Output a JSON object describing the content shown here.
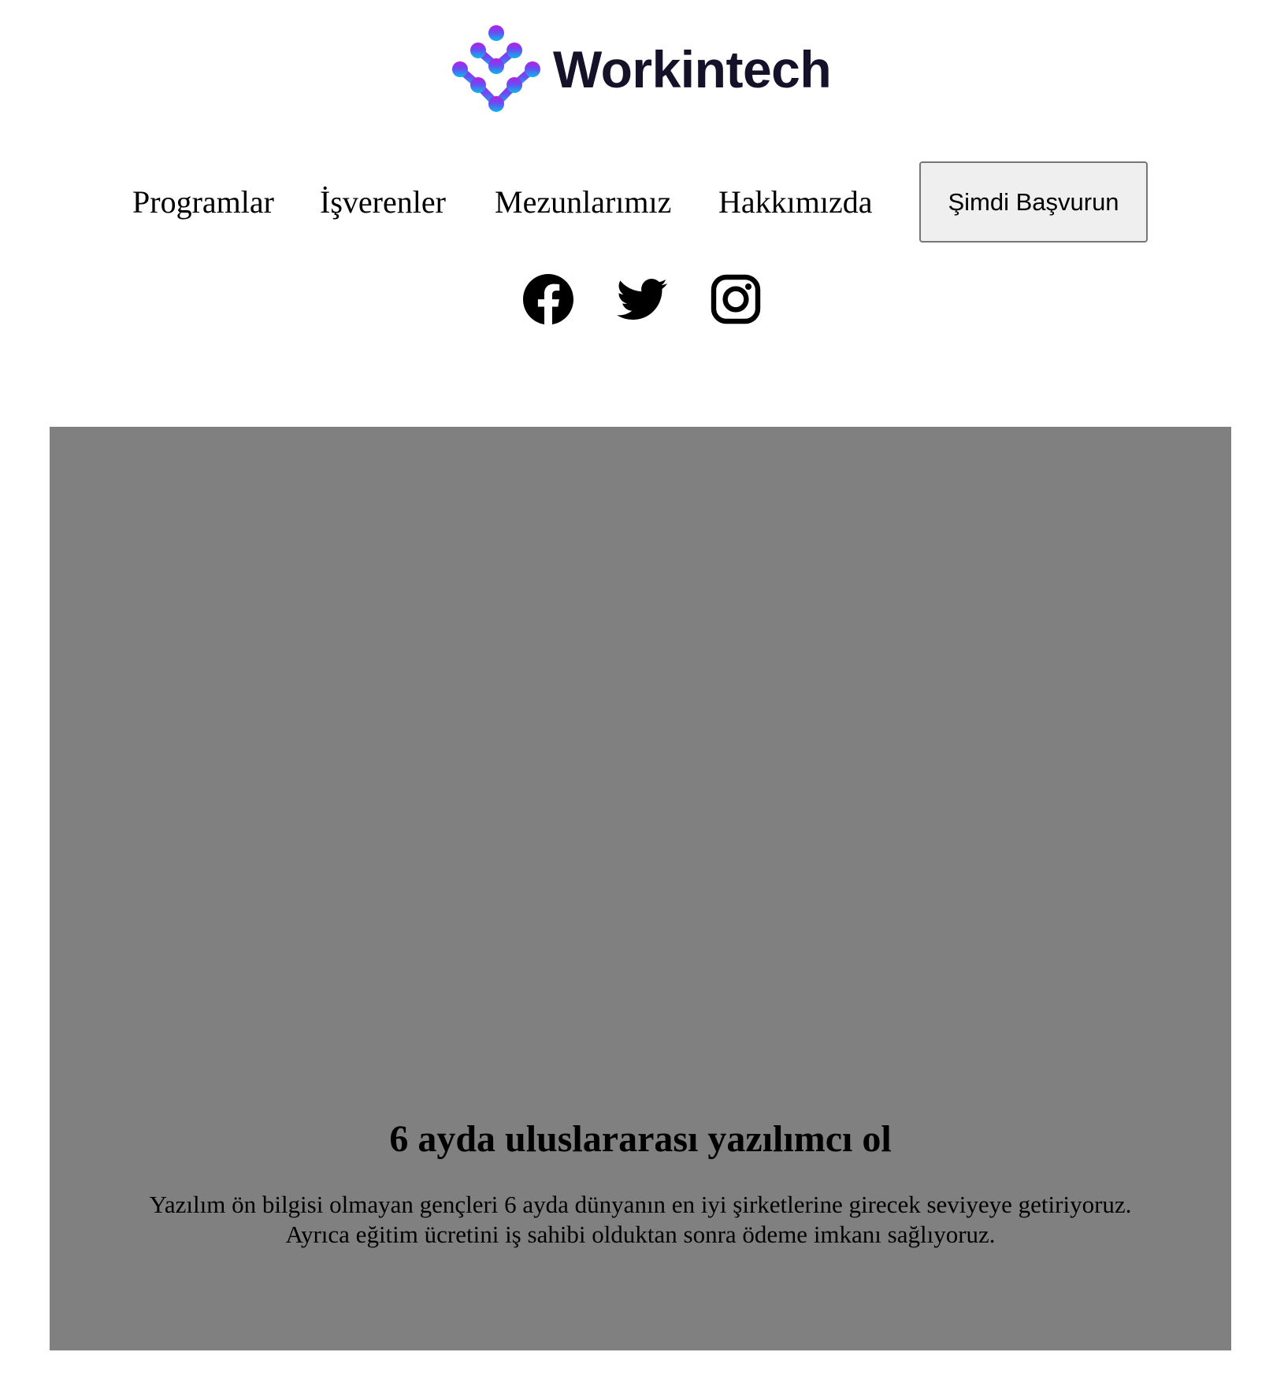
{
  "brand": {
    "name": "Workintech",
    "logo_icon": "workintech-logo-icon",
    "colors": {
      "logo_top": "#b81ee0",
      "logo_mid": "#6a4cf5",
      "logo_bottom": "#08b8ea",
      "text": "#151129"
    }
  },
  "nav": {
    "links": [
      {
        "label": "Programlar"
      },
      {
        "label": "İşverenler"
      },
      {
        "label": "Mezunlarımız"
      },
      {
        "label": "Hakkımızda"
      }
    ],
    "apply_label": "Şimdi Başvurun"
  },
  "socials": [
    {
      "icon": "facebook-icon"
    },
    {
      "icon": "twitter-icon"
    },
    {
      "icon": "instagram-icon"
    }
  ],
  "hero": {
    "background": "#808080",
    "title": "6 ayda uluslararası yazılımcı ol",
    "text_line1": "Yazılım ön bilgisi olmayan gençleri 6 ayda dünyanın en iyi şirketlerine girecek seviyeye getiriyoruz.",
    "text_line2": "Ayrıca eğitim ücretini iş sahibi olduktan sonra ödeme imkanı sağlıyoruz."
  }
}
